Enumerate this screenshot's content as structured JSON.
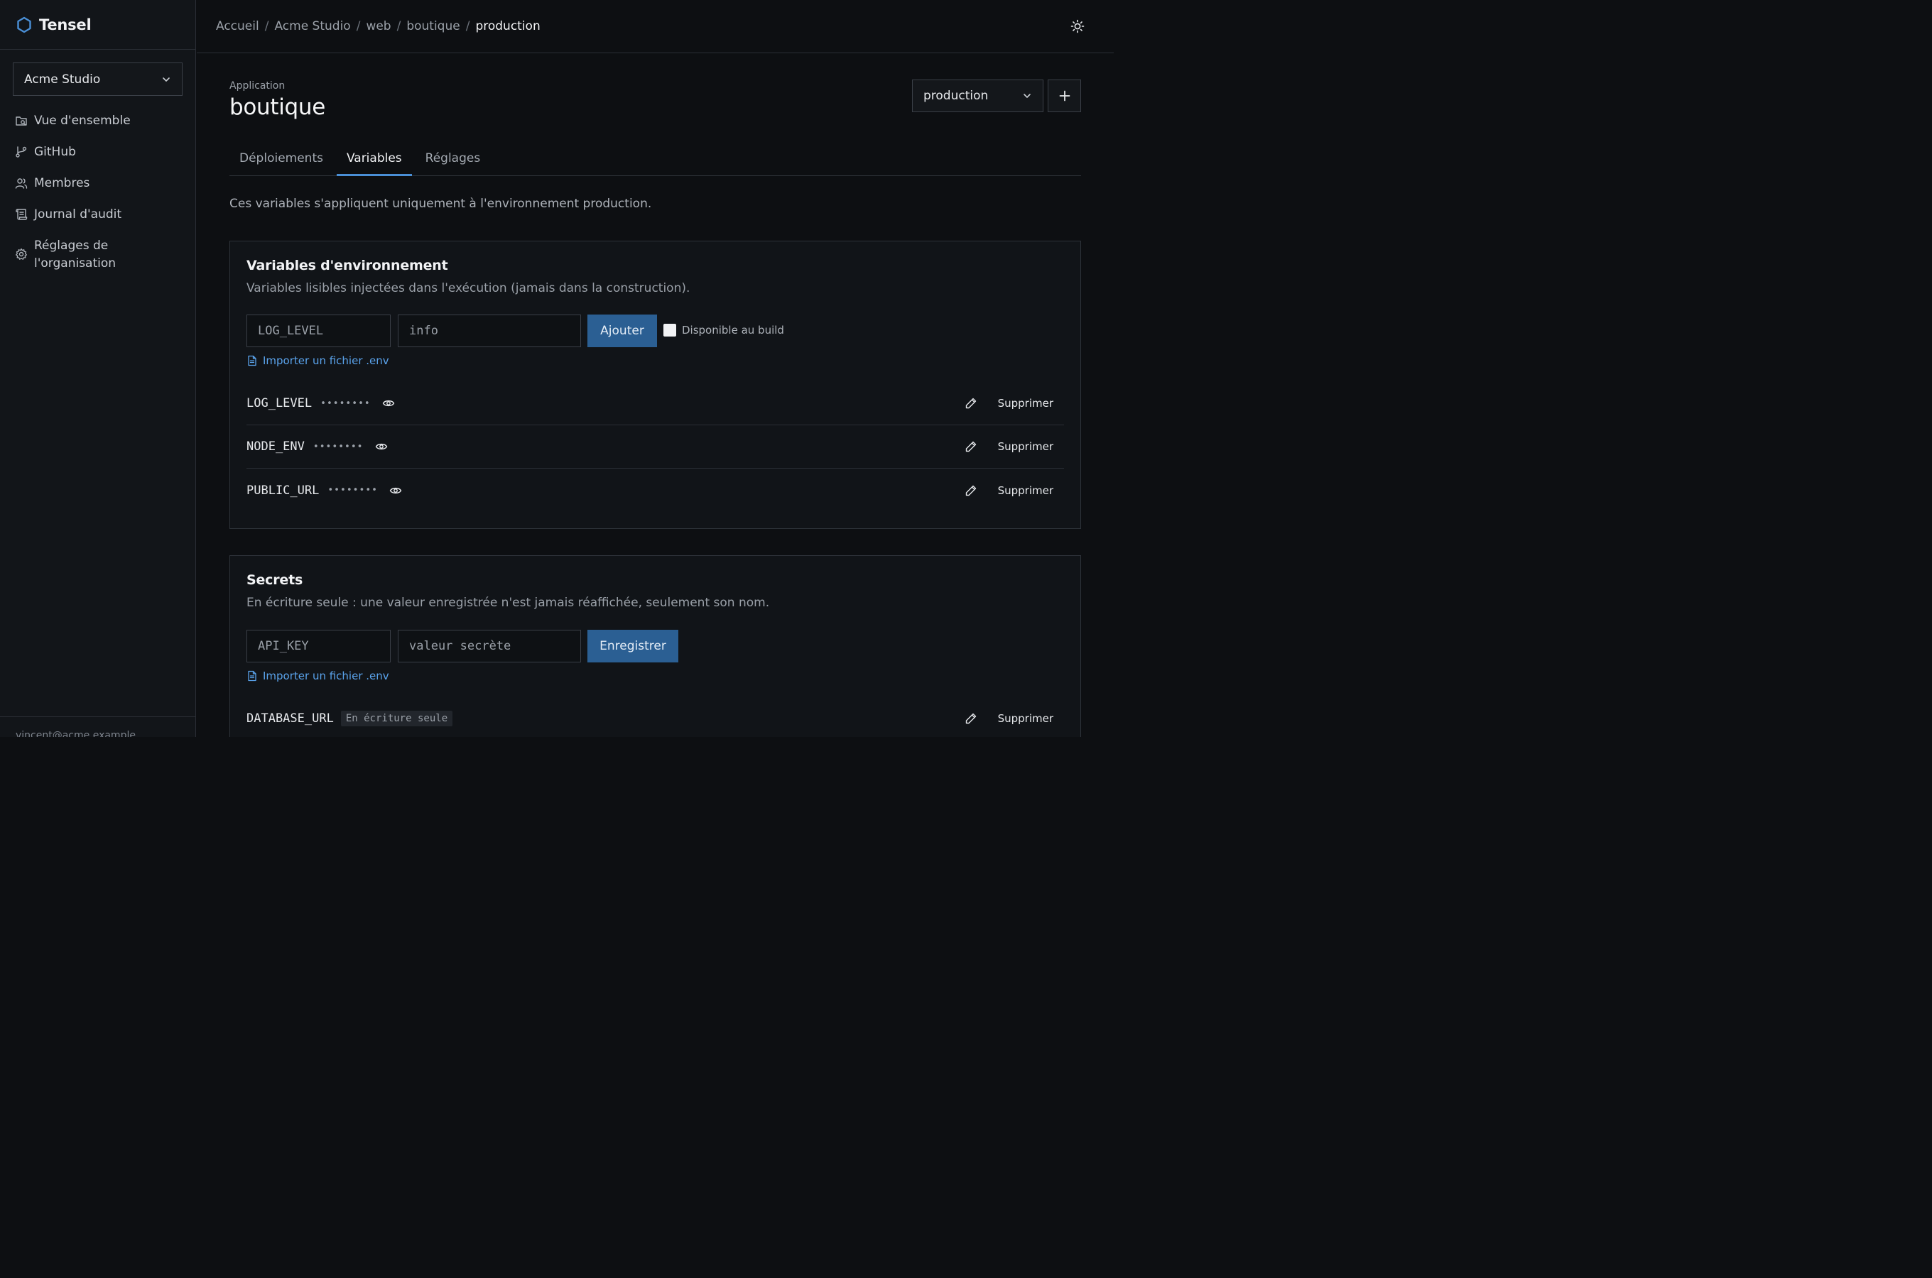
{
  "brand": {
    "name": "Tensel",
    "accent": "#4a8fd6"
  },
  "sidebar": {
    "org": "Acme Studio",
    "items": [
      {
        "label": "Vue d'ensemble",
        "icon": "overview-icon"
      },
      {
        "label": "GitHub",
        "icon": "git-branch-icon"
      },
      {
        "label": "Membres",
        "icon": "users-icon"
      },
      {
        "label": "Journal d'audit",
        "icon": "scroll-icon"
      },
      {
        "label": "Réglages de l'organisation",
        "icon": "gear-icon"
      }
    ],
    "user_email": "vincent@acme.example"
  },
  "breadcrumb": [
    "Accueil",
    "Acme Studio",
    "web",
    "boutique",
    "production"
  ],
  "header": {
    "eyebrow": "Application",
    "title": "boutique",
    "environment": "production"
  },
  "tabs": [
    {
      "label": "Déploiements",
      "active": false
    },
    {
      "label": "Variables",
      "active": true
    },
    {
      "label": "Réglages",
      "active": false
    }
  ],
  "intro": "Ces variables s'appliquent uniquement à l'environnement production.",
  "env_vars": {
    "title": "Variables d'environnement",
    "description": "Variables lisibles injectées dans l'exécution (jamais dans la construction).",
    "key_placeholder": "LOG_LEVEL",
    "value_placeholder": "info",
    "add_label": "Ajouter",
    "build_checkbox_label": "Disponible au build",
    "build_checkbox_checked": false,
    "import_label": "Importer un fichier .env",
    "rows": [
      {
        "name": "LOG_LEVEL",
        "mask": "••••••••",
        "delete": "Supprimer"
      },
      {
        "name": "NODE_ENV",
        "mask": "••••••••",
        "delete": "Supprimer"
      },
      {
        "name": "PUBLIC_URL",
        "mask": "••••••••",
        "delete": "Supprimer"
      }
    ]
  },
  "secrets": {
    "title": "Secrets",
    "description": "En écriture seule : une valeur enregistrée n'est jamais réaffichée, seulement son nom.",
    "key_placeholder": "API_KEY",
    "value_placeholder": "valeur secrète",
    "save_label": "Enregistrer",
    "import_label": "Importer un fichier .env",
    "rows": [
      {
        "name": "DATABASE_URL",
        "badge": "En écriture seule",
        "delete": "Supprimer"
      }
    ]
  }
}
